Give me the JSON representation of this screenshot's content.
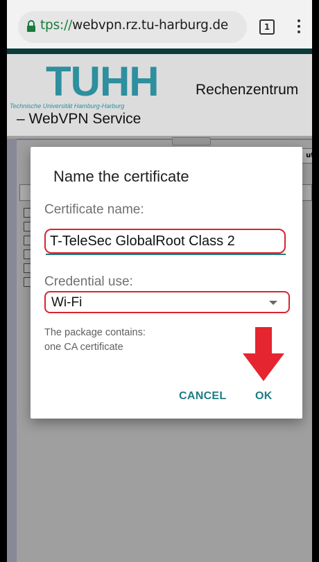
{
  "browser": {
    "url_scheme": "tps://",
    "url_host": "webvpn.rz.tu-harburg.de",
    "tab_count": "1"
  },
  "header": {
    "logo": "TUHH",
    "logo_subtitle": "Technische Universität Hamburg-Harburg",
    "department": "Rechenzentrum",
    "service": "– WebVPN Service"
  },
  "background": {
    "logout_fragment": "ut"
  },
  "dialog": {
    "title": "Name the certificate",
    "name_label": "Certificate name:",
    "name_value": "T-TeleSec GlobalRoot Class 2",
    "use_label": "Credential use:",
    "use_value": "Wi-Fi",
    "info_line1": "The package contains:",
    "info_line2": "one CA certificate",
    "cancel_label": "CANCEL",
    "ok_label": "OK"
  },
  "colors": {
    "accent": "#1f7c84",
    "highlight": "#d9232e",
    "logo": "#2e8f9e"
  }
}
